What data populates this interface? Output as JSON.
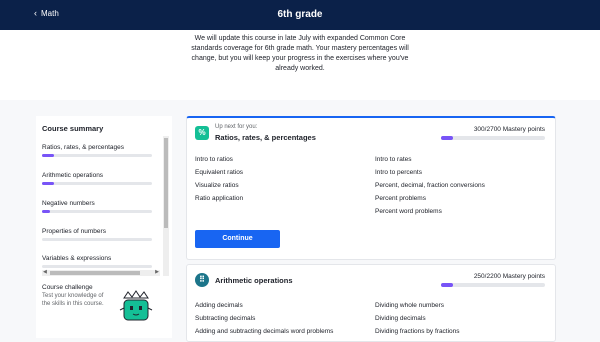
{
  "header": {
    "back_label": "Math",
    "title": "6th grade"
  },
  "notice": "We will update this course in late July with expanded Common Core standards coverage for 6th grade math. Your mastery percentages will change, but you will keep your progress in the exercises where you've already worked.",
  "sidebar": {
    "heading": "Course summary",
    "items": [
      {
        "label": "Ratios, rates, & percentages",
        "progress": 0.11
      },
      {
        "label": "Arithmetic operations",
        "progress": 0.11
      },
      {
        "label": "Negative numbers",
        "progress": 0.07
      },
      {
        "label": "Properties of numbers",
        "progress": 0.0
      },
      {
        "label": "Variables & expressions",
        "progress": 0.0
      }
    ],
    "challenge_title": "Course challenge",
    "challenge_text": "Test your knowledge of the skills in this course."
  },
  "units": [
    {
      "up_next": "Up next for you:",
      "title": "Ratios, rates, & percentages",
      "mastery_label": "300/2700 Mastery points",
      "mastery_fraction": 0.111,
      "skills_left": [
        "Intro to ratios",
        "Equivalent ratios",
        "Visualize ratios",
        "Ratio application"
      ],
      "skills_right": [
        "Intro to rates",
        "Intro to percents",
        "Percent, decimal, fraction conversions",
        "Percent problems",
        "Percent word problems"
      ],
      "continue_label": "Continue",
      "icon": "percent-icon"
    },
    {
      "title": "Arithmetic operations",
      "mastery_label": "250/2200 Mastery points",
      "mastery_fraction": 0.114,
      "skills_left": [
        "Adding decimals",
        "Subtracting decimals",
        "Adding and subtracting decimals word problems"
      ],
      "skills_right": [
        "Dividing whole numbers",
        "Dividing decimals",
        "Dividing fractions by fractions"
      ],
      "icon": "operations-icon"
    }
  ],
  "colors": {
    "header_bg": "#0b2149",
    "accent": "#1865f2",
    "progress": "#7854f7"
  }
}
